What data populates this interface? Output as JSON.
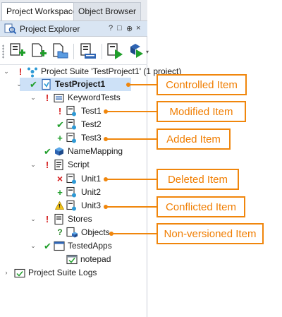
{
  "tabs": [
    {
      "label": "Project Workspace",
      "active": true
    },
    {
      "label": "Object Browser",
      "active": false
    }
  ],
  "explorer": {
    "title": "Project Explorer",
    "header_buttons": [
      "?",
      "□",
      "⊕",
      "×"
    ]
  },
  "toolbar": {
    "buttons": [
      "add-new-project-icon",
      "add-new-item-icon",
      "open-folder-icon",
      "source-control-icon",
      "run-project-icon",
      "run-options-icon"
    ]
  },
  "tree": {
    "suite": {
      "label": "Project Suite 'TestProject1' (1 project)",
      "status": "!"
    },
    "project": {
      "label": "TestProject1",
      "status": "✔"
    },
    "keyword_tests": {
      "label": "KeywordTests",
      "status": "!"
    },
    "test1": {
      "label": "Test1",
      "status": "!"
    },
    "test2": {
      "label": "Test2",
      "status": "✔"
    },
    "test3": {
      "label": "Test3",
      "status": "+"
    },
    "name_mapping": {
      "label": "NameMapping",
      "status": "✔"
    },
    "script": {
      "label": "Script",
      "status": "!"
    },
    "unit1": {
      "label": "Unit1",
      "status": "×"
    },
    "unit2": {
      "label": "Unit2",
      "status": "+"
    },
    "unit3": {
      "label": "Unit3",
      "status": "!"
    },
    "stores": {
      "label": "Stores",
      "status": "!"
    },
    "objects": {
      "label": "Objects",
      "status": "?"
    },
    "tested_apps": {
      "label": "TestedApps",
      "status": "✔"
    },
    "notepad": {
      "label": "notepad"
    },
    "suite_logs": {
      "label": "Project Suite Logs"
    }
  },
  "callouts": {
    "controlled": "Controlled Item",
    "modified": "Modified Item",
    "added": "Added Item",
    "deleted": "Deleted Item",
    "conflicted": "Conflicted Item",
    "nonversioned": "Non-versioned Item"
  },
  "colors": {
    "accent_orange": "#f0860c",
    "selection": "#cde1f7",
    "status_red": "#d41b1b",
    "status_green": "#1f9e2a"
  }
}
